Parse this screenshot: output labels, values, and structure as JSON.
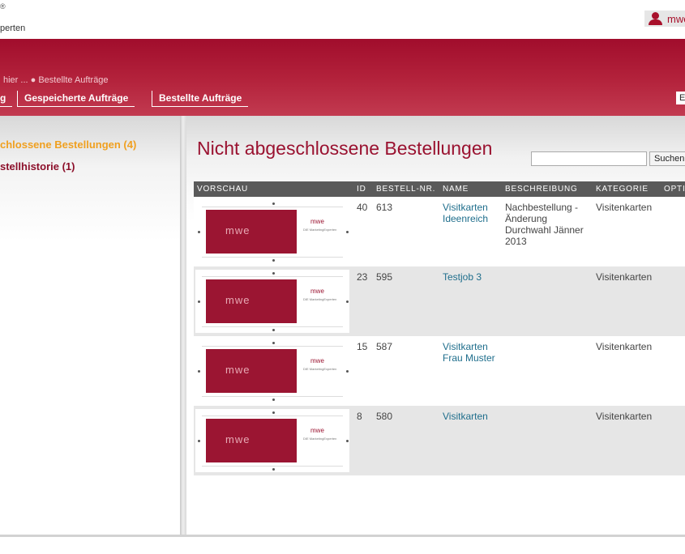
{
  "header": {
    "logo_reg": "®",
    "logo_sub": "perten",
    "user": {
      "name": "mwe",
      "icon": "user-icon",
      "color": "#a8102b"
    },
    "breadcrumb": "hier ... ● Bestellte Aufträge",
    "tabs": [
      {
        "label": "g"
      },
      {
        "label": "Gespeicherte Aufträge"
      },
      {
        "label": "Bestellte Aufträge"
      },
      {
        "label": "E"
      }
    ]
  },
  "sidebar": {
    "items": [
      {
        "label": "chlossene Bestellungen (4)",
        "color": "#f0a020"
      },
      {
        "label": "stellhistorie (1)",
        "color": "#8c0f2a"
      }
    ]
  },
  "main": {
    "title": "Nicht abgeschlossene Bestellungen",
    "search": {
      "value": "",
      "button": "Suchen"
    },
    "table": {
      "headers": [
        "VORSCHAU",
        "ID",
        "BESTELL-NR.",
        "NAME",
        "BESCHREIBUNG",
        "KATEGORIE",
        "OPTI"
      ],
      "rows": [
        {
          "id": "40",
          "nr": "613",
          "name": "Visitkarten Ideenreich",
          "desc": "Nachbestellung - Änderung Durchwahl Jänner 2013",
          "cat": "Visitenkarten"
        },
        {
          "id": "23",
          "nr": "595",
          "name": "Testjob 3",
          "desc": "",
          "cat": "Visitenkarten"
        },
        {
          "id": "15",
          "nr": "587",
          "name": "Visitkarten Frau Muster",
          "desc": "",
          "cat": "Visitenkarten"
        },
        {
          "id": "8",
          "nr": "580",
          "name": "Visitkarten",
          "desc": "",
          "cat": "Visitenkarten"
        }
      ]
    },
    "thumb": {
      "card_logo": "mwe",
      "side_logo": "mwe",
      "side_tag": "DIE MarketingExperten"
    }
  },
  "colors": {
    "brand": "#a10d2c",
    "link": "#1f6e8c",
    "accent": "#f0a020"
  }
}
